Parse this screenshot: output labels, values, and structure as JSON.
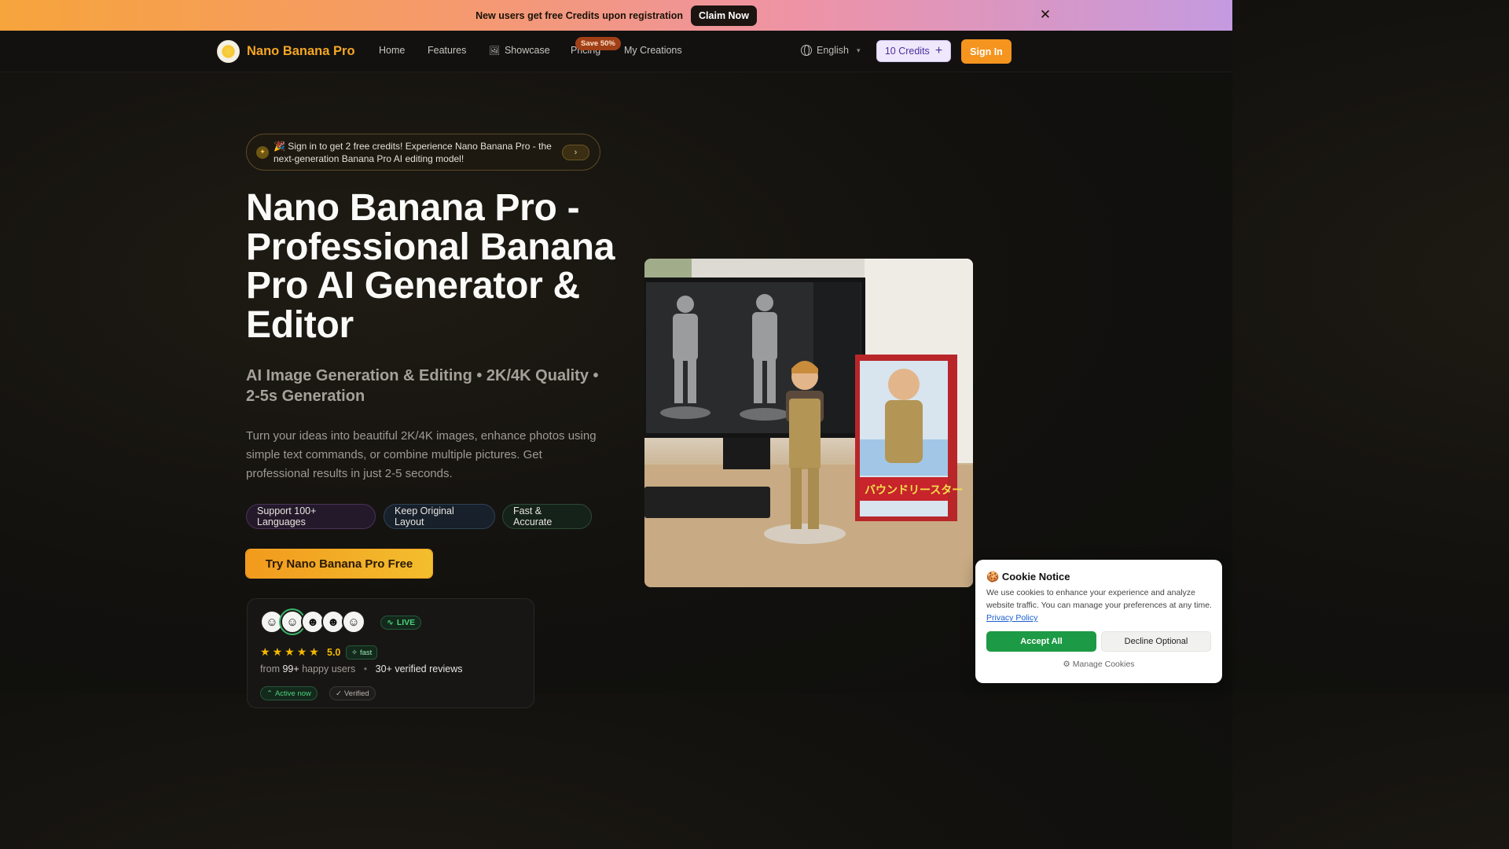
{
  "promo": {
    "text": "New users get free Credits upon registration",
    "button": "Claim Now",
    "close_icon": "close-icon"
  },
  "nav": {
    "logo_text": "Nano Banana Pro",
    "links": [
      "Home",
      "Features",
      "Showcase",
      "Pricing",
      "My Creations"
    ],
    "save_badge": "Save 50%",
    "language": "English",
    "credits": "10 Credits",
    "sign_in": "Sign In"
  },
  "hero": {
    "announcement": "🎉 Sign in to get 2 free credits! Experience Nano Banana Pro - the next-generation Banana Pro AI editing model!",
    "title": "Nano Banana Pro - Professional Banana Pro AI Generator & Editor",
    "subtitle": "AI Image Generation & Editing • 2K/4K Quality • 2-5s Generation",
    "description": "Turn your ideas into beautiful 2K/4K images, enhance photos using simple text commands, or combine multiple pictures. Get professional results in just 2-5 seconds.",
    "pills": [
      "Support 100+ Languages",
      "Keep Original Layout",
      "Fast & Accurate"
    ],
    "cta": "Try Nano Banana Pro Free",
    "image_box_text": "バウンドリースター"
  },
  "social": {
    "live": "LIVE",
    "rating": "5.0",
    "fast": "fast",
    "reviews_prefix": "from",
    "users_count": "99+",
    "users_suffix": "happy users",
    "verified_reviews": "30+ verified reviews",
    "chip_active": "Active now",
    "chip_verified": "Verified"
  },
  "cookie": {
    "title": "Cookie Notice",
    "body": "We use cookies to enhance your experience and analyze website traffic. You can manage your preferences at any time.",
    "policy_link": "Privacy Policy",
    "accept": "Accept All",
    "decline": "Decline Optional",
    "manage": "Manage Cookies"
  },
  "colors": {
    "accent": "#f5941e",
    "brand": "#f5a623",
    "credits_bg": "#efe7fb",
    "accept": "#1d9a45"
  }
}
